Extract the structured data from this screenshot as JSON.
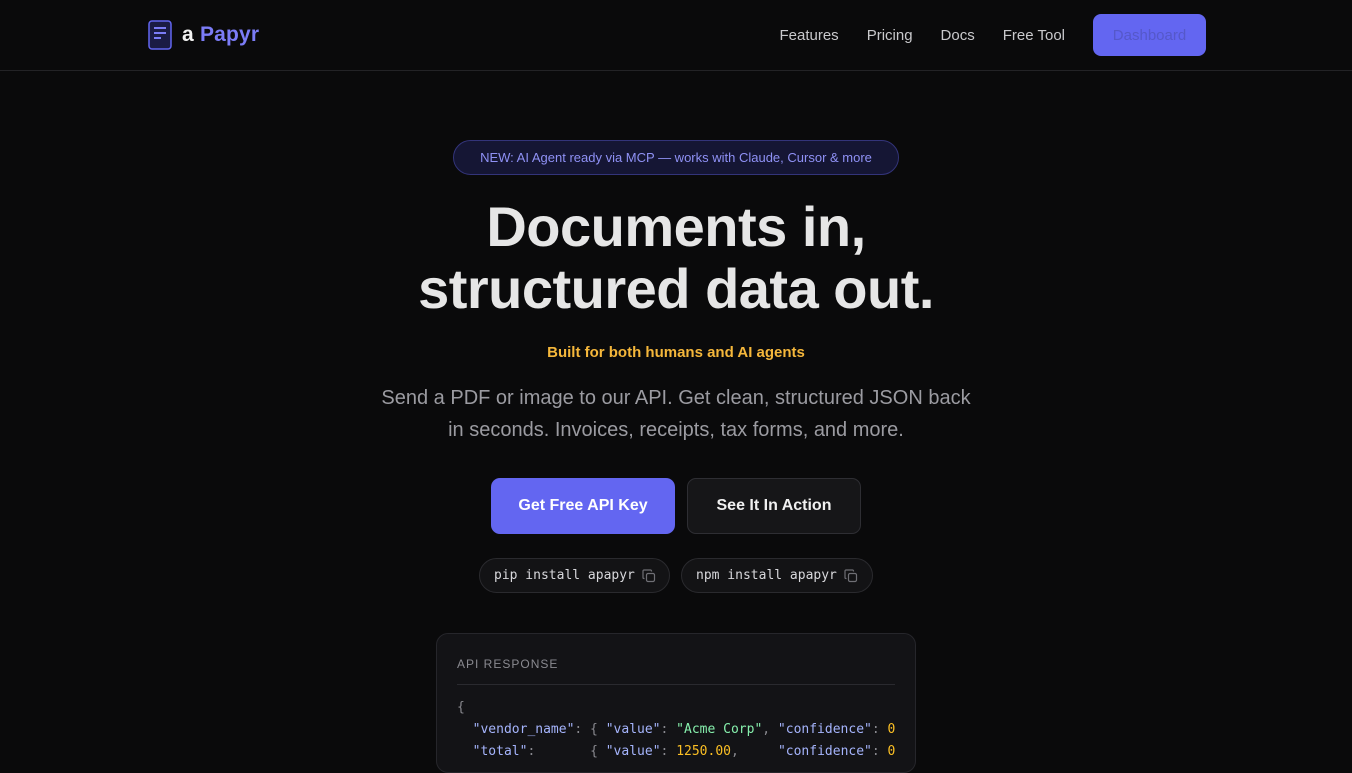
{
  "nav": {
    "logo_a": "a",
    "logo_name": "Papyr",
    "links": [
      "Features",
      "Pricing",
      "Docs",
      "Free Tool"
    ],
    "dashboard_label": "Dashboard"
  },
  "hero": {
    "badge": "NEW: AI Agent ready via MCP — works with Claude, Cursor & more",
    "title_line1": "Documents in,",
    "title_line2": "structured data out.",
    "tagline": "Built for both humans and AI agents",
    "description": "Send a PDF or image to our API. Get clean, structured JSON back in seconds. Invoices, receipts, tax forms, and more.",
    "primary_cta": "Get Free API Key",
    "secondary_cta": "See It In Action",
    "install_pip": "pip install apapyr",
    "install_npm": "npm install apapyr"
  },
  "api_panel": {
    "label": "API RESPONSE",
    "open_brace": "{",
    "lines": [
      {
        "key": "\"vendor_name\"",
        "value": "\"Acme Corp\"",
        "confidence": "0"
      },
      {
        "key": "\"total\"",
        "value": "1250.00",
        "confidence": "0"
      }
    ]
  },
  "colors": {
    "accent": "#6366f1",
    "tagline": "#f5b73b",
    "background": "#0a0a0b"
  },
  "icons": [
    "document-icon",
    "copy-icon"
  ]
}
